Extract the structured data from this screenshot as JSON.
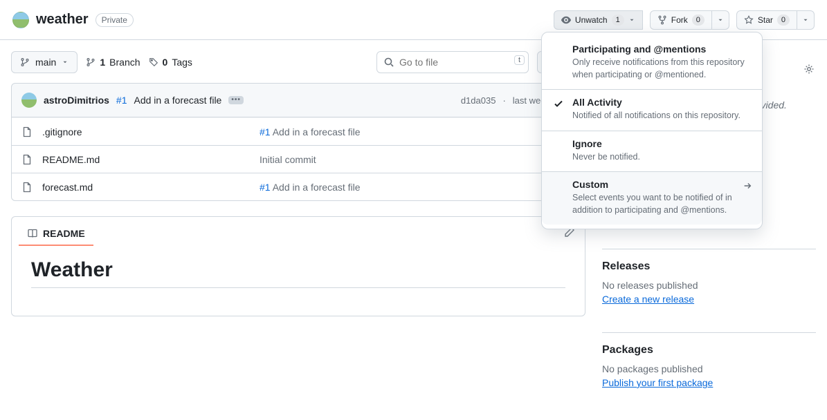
{
  "repo": {
    "name": "weather",
    "visibility": "Private"
  },
  "top_buttons": {
    "watch": {
      "label": "Unwatch",
      "count": "1"
    },
    "fork": {
      "label": "Fork",
      "count": "0"
    },
    "star": {
      "label": "Star",
      "count": "0"
    }
  },
  "branch_bar": {
    "branch": "main",
    "branches_count": "1",
    "branches_word": "Branch",
    "tags_count": "0",
    "tags_word": "Tags",
    "search_placeholder": "Go to file",
    "shortcut": "t"
  },
  "commit": {
    "author": "astroDimitrios",
    "pr_ref": "#1",
    "pr_title": "Add in a forecast file",
    "sha_short": "d1da035",
    "rel_time": "last week"
  },
  "files": [
    {
      "name": ".gitignore",
      "pr_ref": "#1",
      "msg": "Add in a forecast file"
    },
    {
      "name": "README.md",
      "pr_ref": "",
      "msg": "Initial commit"
    },
    {
      "name": "forecast.md",
      "pr_ref": "#1",
      "msg": "Add in a forecast file"
    }
  ],
  "readme": {
    "tab_label": "README",
    "title": "Weather"
  },
  "sidebar": {
    "about_placeholder": "No description, website, or topics provided.",
    "releases": {
      "heading": "Releases",
      "none": "No releases published",
      "link": "Create a new release"
    },
    "packages": {
      "heading": "Packages",
      "none": "No packages published",
      "link": "Publish your first package"
    }
  },
  "watch_menu": [
    {
      "title": "Participating and @mentions",
      "desc": "Only receive notifications from this repository when participating or @mentioned.",
      "checked": false,
      "arrow": false
    },
    {
      "title": "All Activity",
      "desc": "Notified of all notifications on this repository.",
      "checked": true,
      "arrow": false
    },
    {
      "title": "Ignore",
      "desc": "Never be notified.",
      "checked": false,
      "arrow": false
    },
    {
      "title": "Custom",
      "desc": "Select events you want to be notified of in addition to participating and @mentions.",
      "checked": false,
      "arrow": true,
      "hover": true
    }
  ]
}
